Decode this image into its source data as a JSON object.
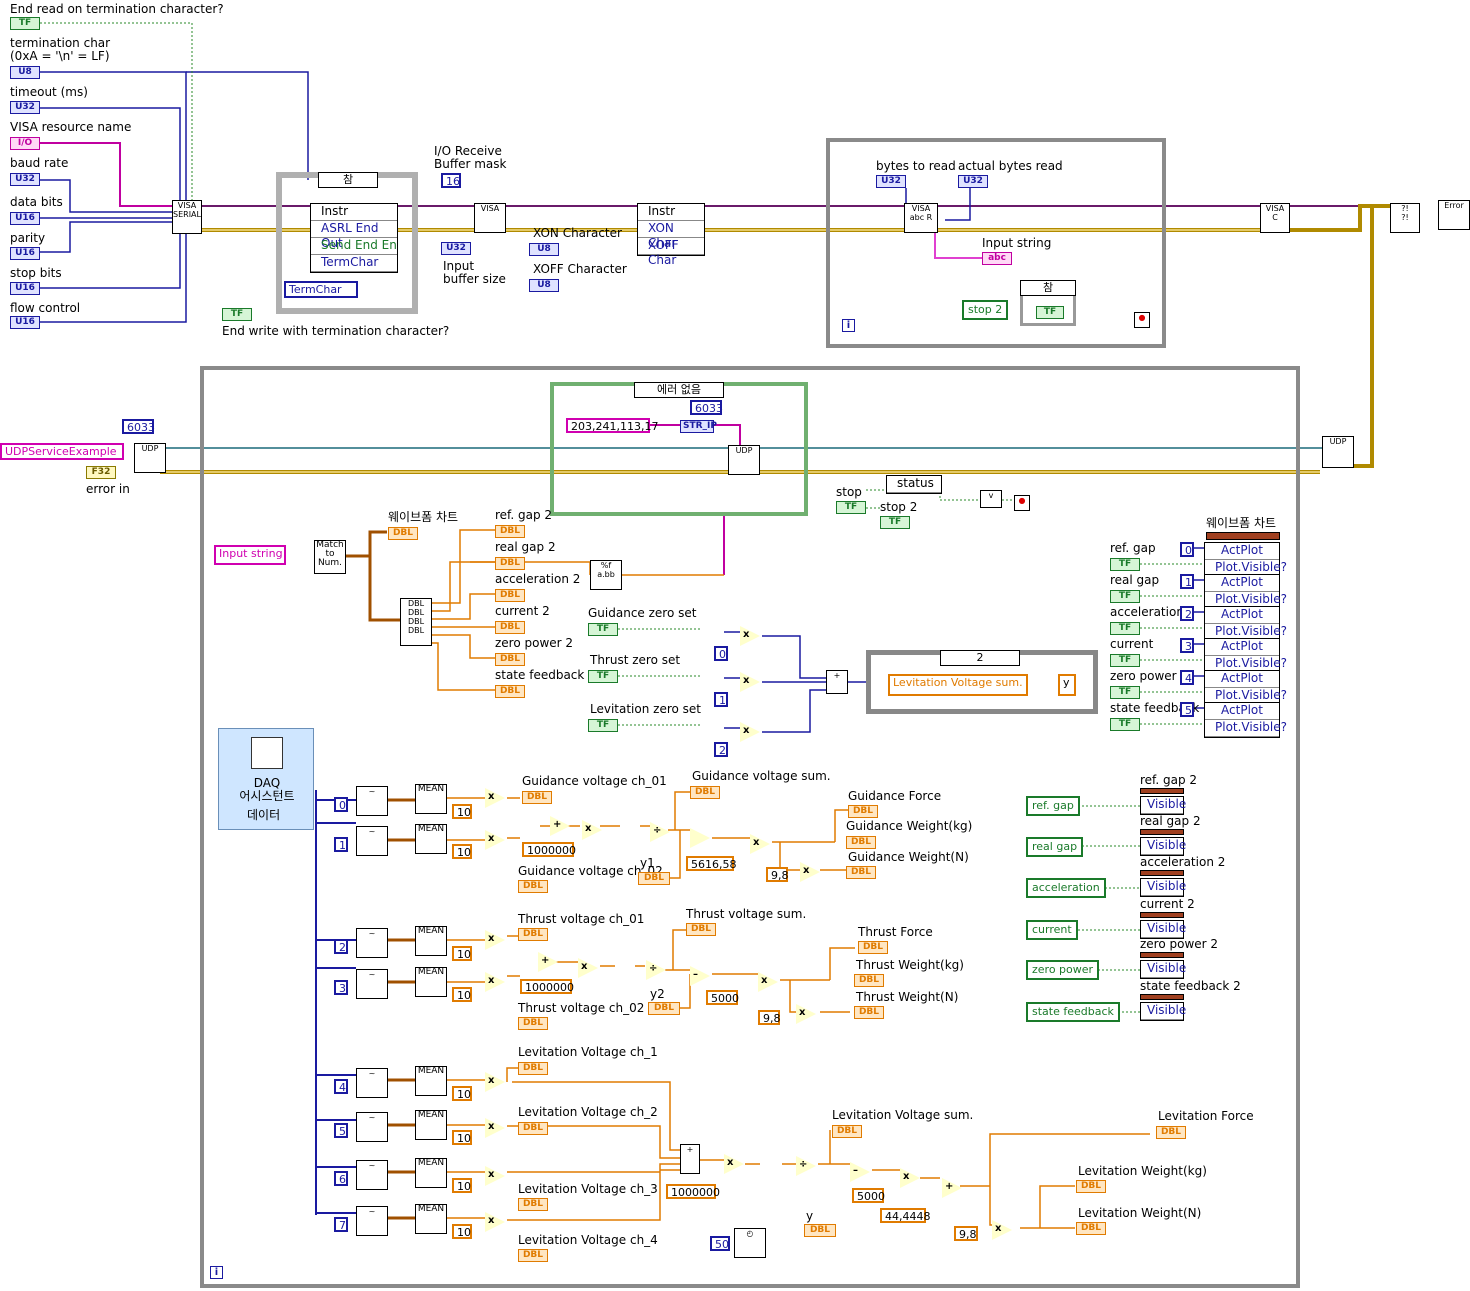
{
  "serial_config": {
    "end_read_label": "End read on termination character?",
    "term_char_label": "termination char\n(0xA = '\\n' = LF)",
    "timeout_label": "timeout (ms)",
    "visa_resource_label": "VISA resource name",
    "baud_rate_label": "baud rate",
    "data_bits_label": "data bits",
    "parity_label": "parity",
    "stop_bits_label": "stop bits",
    "flow_control_label": "flow control",
    "end_write_label": "End write with termination character?"
  },
  "terminals": {
    "tf": "TF",
    "u8": "U8",
    "u32": "U32",
    "u16": "U16",
    "io": "I/O",
    "dbl": "DBL",
    "abc": "abc",
    "str_ip": "STR_IP",
    "f32": "F32"
  },
  "case1": {
    "selector": "참",
    "instr": "Instr",
    "props": [
      "ASRL End Out",
      "Send End En",
      "TermChar"
    ],
    "termchar_ring": "TermChar"
  },
  "io_buffer": {
    "mask_label": "I/O Receive\nBuffer mask",
    "mask_value": "16",
    "size_label": "Input\nbuffer size"
  },
  "xon_node": {
    "instr": "Instr",
    "props": [
      "XON Char",
      "XOFF Char"
    ],
    "xon_label": "XON Character",
    "xoff_label": "XOFF Character"
  },
  "read_loop": {
    "bytes_to_read": "bytes to read",
    "actual_bytes": "actual bytes read",
    "input_string": "Input string",
    "case_selector": "참",
    "stop2": "stop 2",
    "iter": "i"
  },
  "udp": {
    "port": "6033",
    "service": "UDPServiceExample",
    "error_in": "error in",
    "case_selector": "에러 없음",
    "case_port": "6033",
    "ip": "203,241,113,17",
    "status": "status",
    "stop": "stop",
    "stop2": "stop 2"
  },
  "parse": {
    "input_string": "Input string",
    "match": "Match\nto\nNum.",
    "waveform_label": "웨이브폼 차트",
    "outputs": [
      "ref. gap 2",
      "real gap 2",
      "acceleration 2",
      "current 2",
      "zero power 2",
      "state feedback 2"
    ]
  },
  "zero_set": {
    "guidance": "Guidance zero set",
    "thrust": "Thrust zero set",
    "levitation": "Levitation zero set",
    "consts": [
      "0",
      "1",
      "2"
    ],
    "case_selector": "2",
    "lev_sum_local": "Levitation Voltage sum.",
    "y": "y"
  },
  "chart_props": {
    "title": "웨이브폼 차트",
    "labels": [
      "ref. gap",
      "real gap",
      "acceleration",
      "current",
      "zero power",
      "state feedback"
    ],
    "indices": [
      "0",
      "1",
      "2",
      "3",
      "4",
      "5"
    ],
    "actplot": "ActPlot",
    "visible": "Plot.Visible?"
  },
  "visible_buttons": {
    "buttons": [
      "ref. gap",
      "real gap",
      "acceleration",
      "current",
      "zero power",
      "state feedback"
    ],
    "targets": [
      "ref. gap 2",
      "real gap 2",
      "acceleration 2",
      "current 2",
      "zero power 2",
      "state feedback 2"
    ],
    "prop": "Visible"
  },
  "daq": {
    "title": "DAQ\n어시스턴트",
    "data": "데이터"
  },
  "guidance": {
    "ch1": "Guidance voltage ch_01",
    "ch2": "Guidance voltage ch_02",
    "sum": "Guidance voltage sum.",
    "force": "Guidance Force",
    "weight_kg": "Guidance Weight(kg)",
    "weight_n": "Guidance Weight(N)",
    "y1": "y1",
    "million": "1000000",
    "k": "5616,58",
    "g": "9,8",
    "chan": [
      "0",
      "1"
    ]
  },
  "thrust": {
    "ch1": "Thrust voltage ch_01",
    "ch2": "Thrust voltage ch_02",
    "sum": "Thrust voltage sum.",
    "force": "Thrust Force",
    "weight_kg": "Thrust Weight(kg)",
    "weight_n": "Thrust Weight(N)",
    "y2": "y2",
    "million": "1000000",
    "k": "5000",
    "g": "9,8",
    "chan": [
      "2",
      "3"
    ]
  },
  "levitation": {
    "ch1": "Levitation Voltage ch_1",
    "ch2": "Levitation Voltage ch_2",
    "ch3": "Levitation Voltage ch_3",
    "ch4": "Levitation Voltage ch_4",
    "sum": "Levitation Voltage sum.",
    "force": "Levitation Force",
    "weight_kg": "Levitation Weight(kg)",
    "weight_n": "Levitation Weight(N)",
    "y": "y",
    "million": "1000000",
    "k": "5000",
    "k2": "44,4448",
    "g": "9,8",
    "chan": [
      "4",
      "5",
      "6",
      "7"
    ]
  },
  "mean": "MEAN",
  "ten": "10",
  "wait_ms": "50",
  "main_loop_iter": "i",
  "error_out": "Error"
}
